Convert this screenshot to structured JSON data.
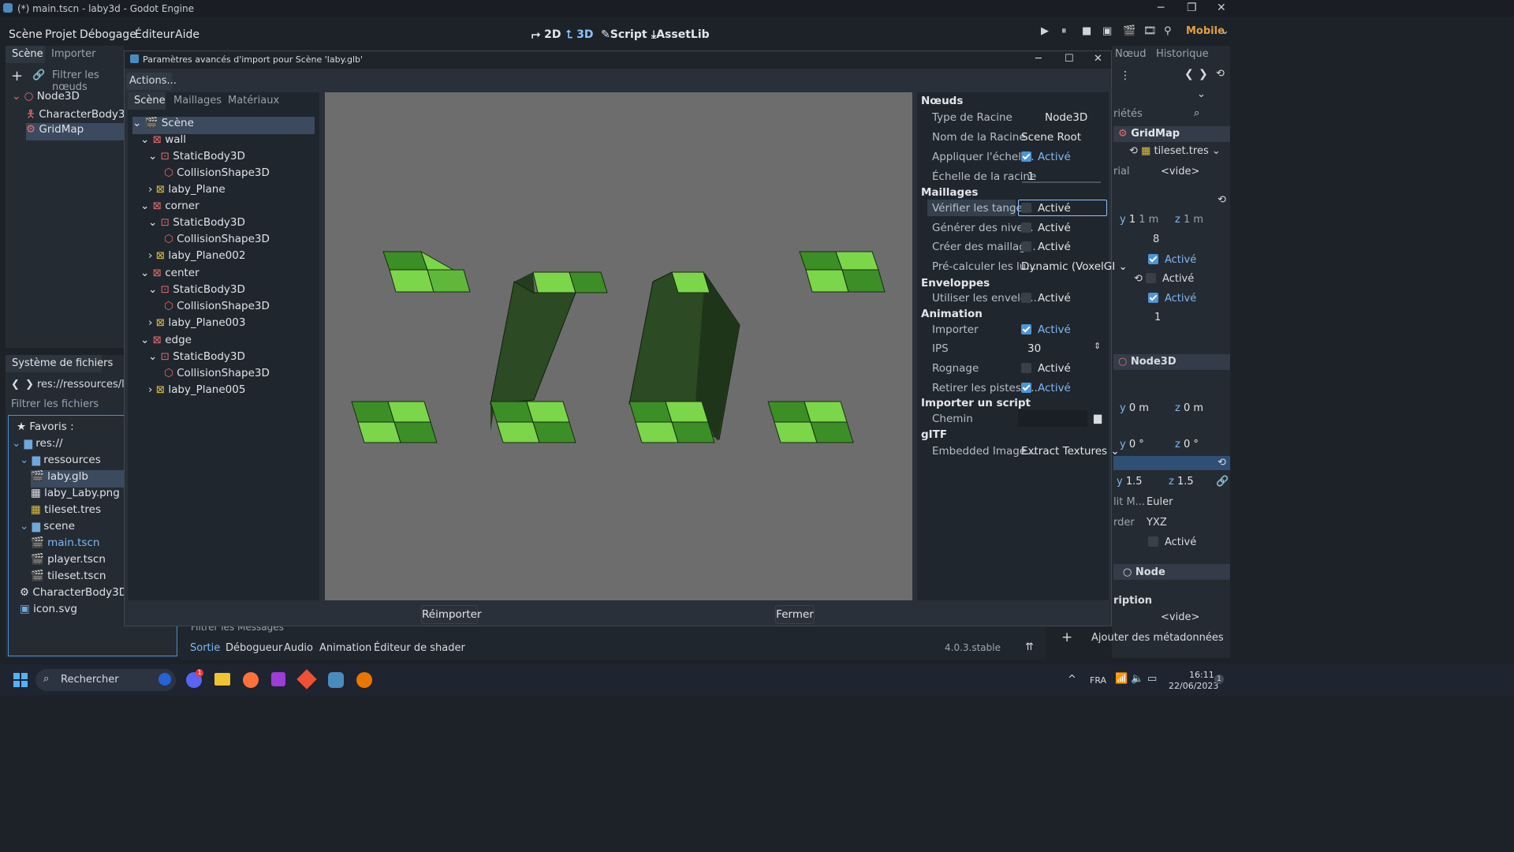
{
  "window": {
    "title": "(*) main.tscn - laby3d - Godot Engine"
  },
  "menu": [
    "Scène",
    "Projet",
    "Débogage",
    "Éditeur",
    "Aide"
  ],
  "workspaces": [
    "2D",
    "3D",
    "Script",
    "AssetLib"
  ],
  "renderer": "Mobile",
  "left_dock": {
    "tabs": [
      "Scène",
      "Importer"
    ],
    "filter_placeholder": "Filtrer les nœuds",
    "nodes": [
      "Node3D",
      "CharacterBody3D",
      "GridMap"
    ]
  },
  "filesystem": {
    "title": "Système de fichiers",
    "path": "res://ressources/laby",
    "filter_placeholder": "Filtrer les fichiers",
    "items": [
      "Favoris :",
      "res://",
      "ressources",
      "laby.glb",
      "laby_Laby.png",
      "tileset.tres",
      "scene",
      "main.tscn",
      "player.tscn",
      "tileset.tscn",
      "CharacterBody3D.gd",
      "icon.svg"
    ]
  },
  "dialog": {
    "title": "Paramètres avancés d'import pour Scène 'laby.glb'",
    "actions_label": "Actions...",
    "tabs": [
      "Scène",
      "Maillages",
      "Matériaux"
    ],
    "tree": [
      "Scène",
      "wall",
      "StaticBody3D",
      "CollisionShape3D",
      "laby_Plane",
      "corner",
      "StaticBody3D",
      "CollisionShape3D",
      "laby_Plane002",
      "center",
      "StaticBody3D",
      "CollisionShape3D",
      "laby_Plane003",
      "edge",
      "StaticBody3D",
      "CollisionShape3D",
      "laby_Plane005"
    ],
    "reimport_label": "Réimporter",
    "close_label": "Fermer",
    "props": {
      "noeuds": "Nœuds",
      "type_racine_l": "Type de Racine",
      "type_racine_v": "Node3D",
      "nom_racine_l": "Nom de la Racine",
      "nom_racine_v": "Scene Root",
      "appliquer_l": "Appliquer l'échell...",
      "echelle_l": "Échelle de la racine",
      "echelle_v": "1",
      "maillages": "Maillages",
      "verifier_l": "Vérifier les tange...",
      "generer_l": "Générer des nive...",
      "creer_l": "Créer des maillag...",
      "precalc_l": "Pré-calculer les lu...",
      "precalc_v": "Dynamic (VoxelGI",
      "enveloppes": "Enveloppes",
      "utiliser_l": "Utiliser les envelo...",
      "animation": "Animation",
      "importer_l": "Importer",
      "ips_l": "IPS",
      "ips_v": "30",
      "rognage_l": "Rognage",
      "retirer_l": "Retirer les pistes i...",
      "script": "Importer un script",
      "chemin_l": "Chemin",
      "gltf": "gITF",
      "embedded_l": "Embedded Image...",
      "embedded_v": "Extract Textures",
      "active": "Activé"
    }
  },
  "right_dock": {
    "tabs": [
      "Nœud",
      "Historique"
    ],
    "search_placeholder": "riétés",
    "node_name": "GridMap",
    "tileset": "tileset.tres",
    "rial_l": "rial",
    "vide": "<vide>",
    "y1": "1 m",
    "z1": "1 m",
    "eight": "8",
    "one": "1",
    "node3d": "Node3D",
    "zero_m": "0 m",
    "zero_deg": "0 °",
    "scale": "1.5",
    "euler_l": "lit M...",
    "euler_v": "Euler",
    "order_l": "rder",
    "order_v": "YXZ",
    "node": "Node",
    "description": "ription",
    "add_meta": "Ajouter des métadonnées",
    "active": "Activé"
  },
  "bottom": {
    "filter_placeholder": "Filtrer les Messages",
    "tabs": [
      "Sortie",
      "Débogueur",
      "Audio",
      "Animation",
      "Éditeur de shader"
    ],
    "version": "4.0.3.stable"
  },
  "taskbar": {
    "search": "Rechercher",
    "lang": "FRA",
    "time": "16:11",
    "date": "22/06/2023",
    "badge": "1"
  },
  "colors": {
    "accent": "#478cbf",
    "checked": "#4b96d9",
    "tile_light": "#7bd64a",
    "tile_dark": "#3c8e26",
    "brick": "#2c4a24"
  }
}
